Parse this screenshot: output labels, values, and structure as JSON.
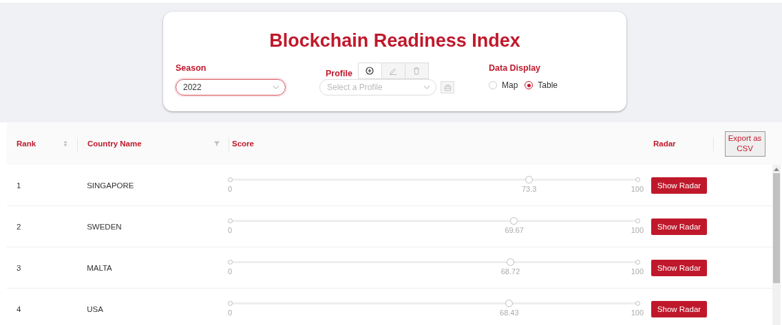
{
  "header": {
    "title": "Blockchain Readiness Index"
  },
  "season": {
    "label": "Season",
    "value": "2022"
  },
  "profile": {
    "label": "Profile",
    "placeholder": "Select a Profile"
  },
  "data_display": {
    "label": "Data Display",
    "options": [
      {
        "label": "Map",
        "selected": false
      },
      {
        "label": "Table",
        "selected": true
      }
    ]
  },
  "table": {
    "columns": [
      "Rank",
      "Country Name",
      "Score",
      "Radar"
    ],
    "export_button": "Export as CSV",
    "rows": [
      {
        "rank": "1",
        "country": "SINGAPORE",
        "min": "0",
        "score": "73.3",
        "max": "100",
        "level": 0.733,
        "button": "Show Radar"
      },
      {
        "rank": "2",
        "country": "SWEDEN",
        "min": "0",
        "score": "69.67",
        "max": "100",
        "level": 0.6967,
        "button": "Show Radar"
      },
      {
        "rank": "3",
        "country": "MALTA",
        "min": "0",
        "score": "68.72",
        "max": "100",
        "level": 0.6872,
        "button": "Show Radar"
      },
      {
        "rank": "4",
        "country": "USA",
        "min": "0",
        "score": "68.43",
        "max": "100",
        "level": 0.6843,
        "button": "Show Radar"
      }
    ]
  }
}
